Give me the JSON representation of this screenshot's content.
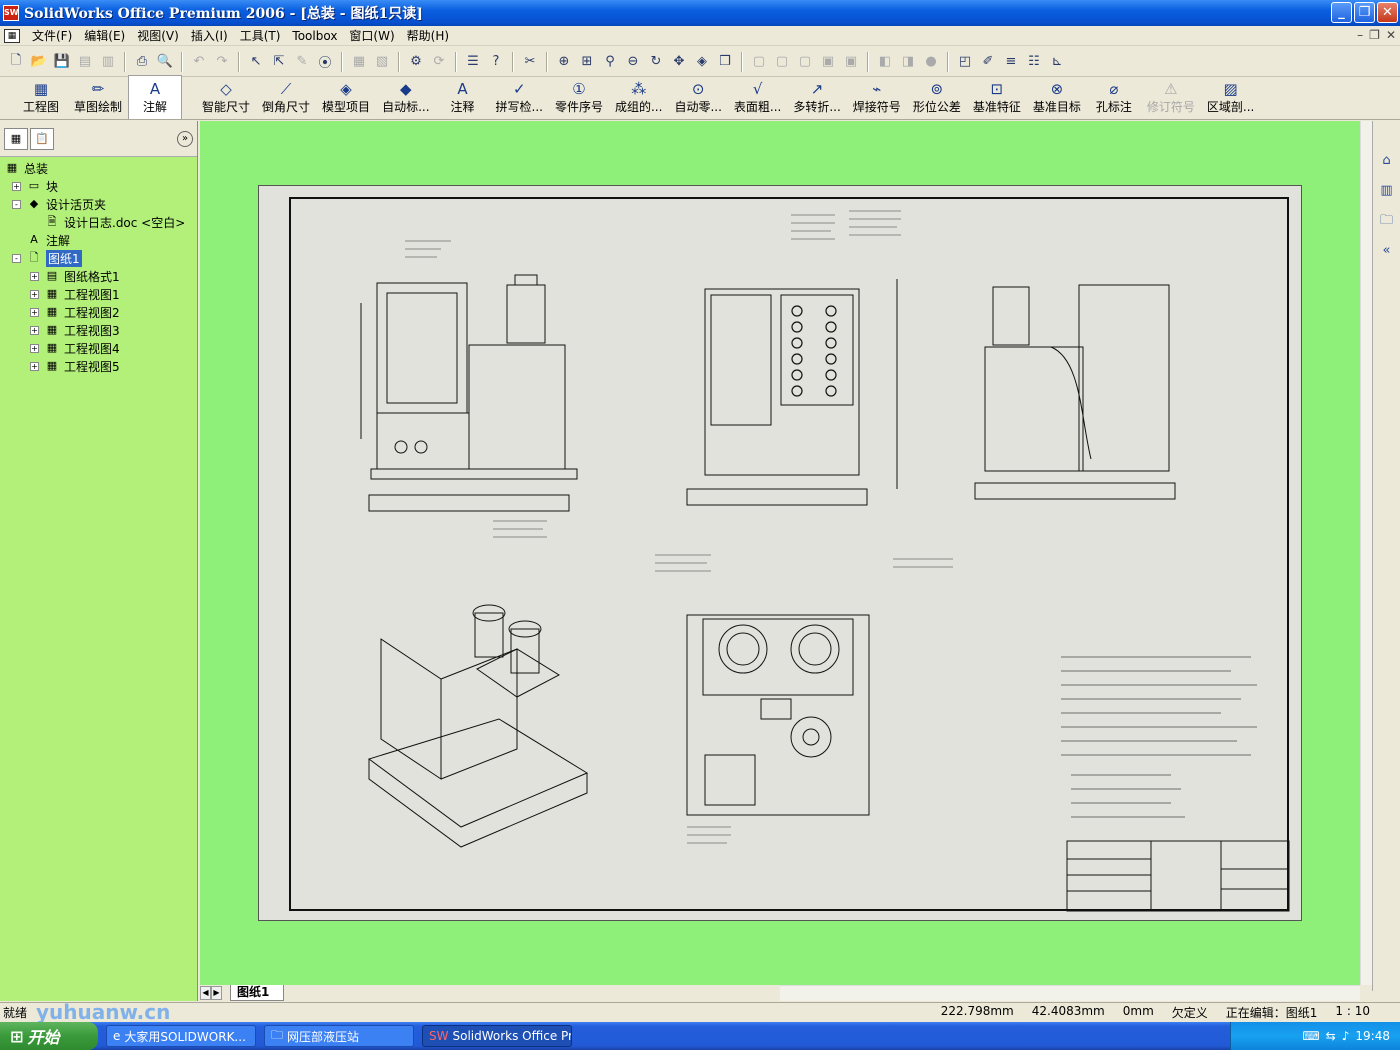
{
  "window": {
    "title": "SolidWorks Office Premium 2006 - [总装 - 图纸1只读]"
  },
  "menu": [
    "文件(F)",
    "编辑(E)",
    "视图(V)",
    "插入(I)",
    "工具(T)",
    "Toolbox",
    "窗口(W)",
    "帮助(H)"
  ],
  "command_manager": {
    "groups": [
      {
        "label": "工程图",
        "icon": "drawing-icon"
      },
      {
        "label": "草图绘制",
        "icon": "sketch-icon"
      },
      {
        "label": "注解",
        "icon": "annotation-icon"
      }
    ],
    "items": [
      "智能尺寸",
      "倒角尺寸",
      "模型项目",
      "自动标...",
      "注释",
      "拼写检...",
      "零件序号",
      "成组的...",
      "自动零...",
      "表面粗...",
      "多转折...",
      "焊接符号",
      "形位公差",
      "基准特征",
      "基准目标",
      "孔标注",
      "修订符号",
      "区域剖..."
    ]
  },
  "feature_tree": {
    "root": "总装",
    "items": [
      {
        "label": "块",
        "icon": "block-icon",
        "level": 1,
        "expander": "+"
      },
      {
        "label": "设计活页夹",
        "icon": "binder-icon",
        "level": 1,
        "expander": "-"
      },
      {
        "label": "设计日志.doc <空白>",
        "icon": "doc-icon",
        "level": 2,
        "expander": ""
      },
      {
        "label": "注解",
        "icon": "annotation-folder-icon",
        "level": 1,
        "expander": ""
      },
      {
        "label": "图纸1",
        "icon": "sheet-icon",
        "level": 1,
        "expander": "-",
        "selected": true
      },
      {
        "label": "图纸格式1",
        "icon": "sheet-format-icon",
        "level": 2,
        "expander": "+"
      },
      {
        "label": "工程视图1",
        "icon": "drawing-view-icon",
        "level": 2,
        "expander": "+"
      },
      {
        "label": "工程视图2",
        "icon": "drawing-view-icon",
        "level": 2,
        "expander": "+"
      },
      {
        "label": "工程视图3",
        "icon": "drawing-view-icon",
        "level": 2,
        "expander": "+"
      },
      {
        "label": "工程视图4",
        "icon": "drawing-view-icon",
        "level": 2,
        "expander": "+"
      },
      {
        "label": "工程视图5",
        "icon": "drawing-view-icon",
        "level": 2,
        "expander": "+"
      }
    ]
  },
  "sheet_tab": "图纸1",
  "status": {
    "ready": "就绪",
    "x": "222.798mm",
    "y": "42.4083mm",
    "z": "0mm",
    "defined": "欠定义",
    "editing": "正在编辑：图纸1",
    "scale": "1 : 10"
  },
  "taskbar": {
    "start": "开始",
    "tasks": [
      "大家用SOLIDWORK...",
      "网压部液压站",
      "SolidWorks Office Pre..."
    ],
    "time": "19:48"
  },
  "watermark": "yuhuanw.cn"
}
